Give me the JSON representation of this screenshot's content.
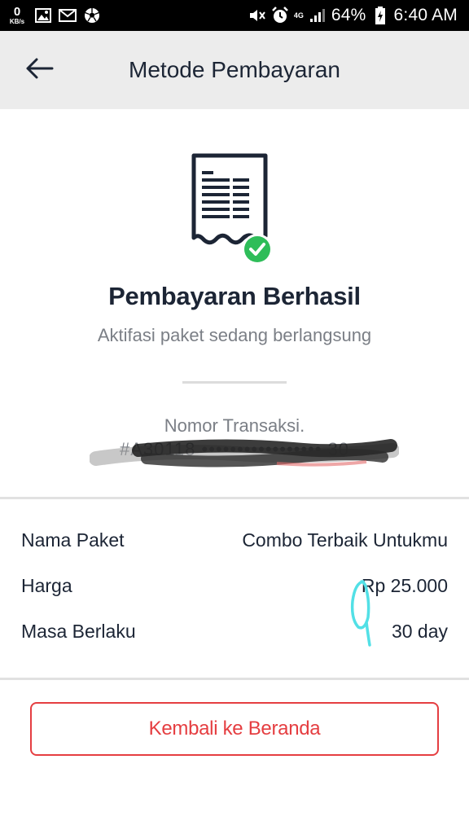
{
  "status_bar": {
    "speed_value": "0",
    "speed_unit": "KB/s",
    "network": "4G",
    "battery": "64%",
    "time": "6:40 AM"
  },
  "app_bar": {
    "title": "Metode Pembayaran"
  },
  "success": {
    "title": "Pembayaran Berhasil",
    "subtitle": "Aktifasi paket sedang berlangsung",
    "transaction_label": "Nomor Transaksi.",
    "transaction_number": "#A30118 ••••••••••••••••• 30"
  },
  "details": [
    {
      "label": "Nama Paket",
      "value": "Combo Terbaik Untukmu"
    },
    {
      "label": "Harga",
      "value": "Rp 25.000"
    },
    {
      "label": "Masa Berlaku",
      "value": "30 day"
    }
  ],
  "button": {
    "label": "Kembali ke Beranda"
  },
  "colors": {
    "accent": "#e53e41",
    "success": "#2ebd59",
    "navy": "#1c2535",
    "appbar_bg": "#ececec"
  }
}
